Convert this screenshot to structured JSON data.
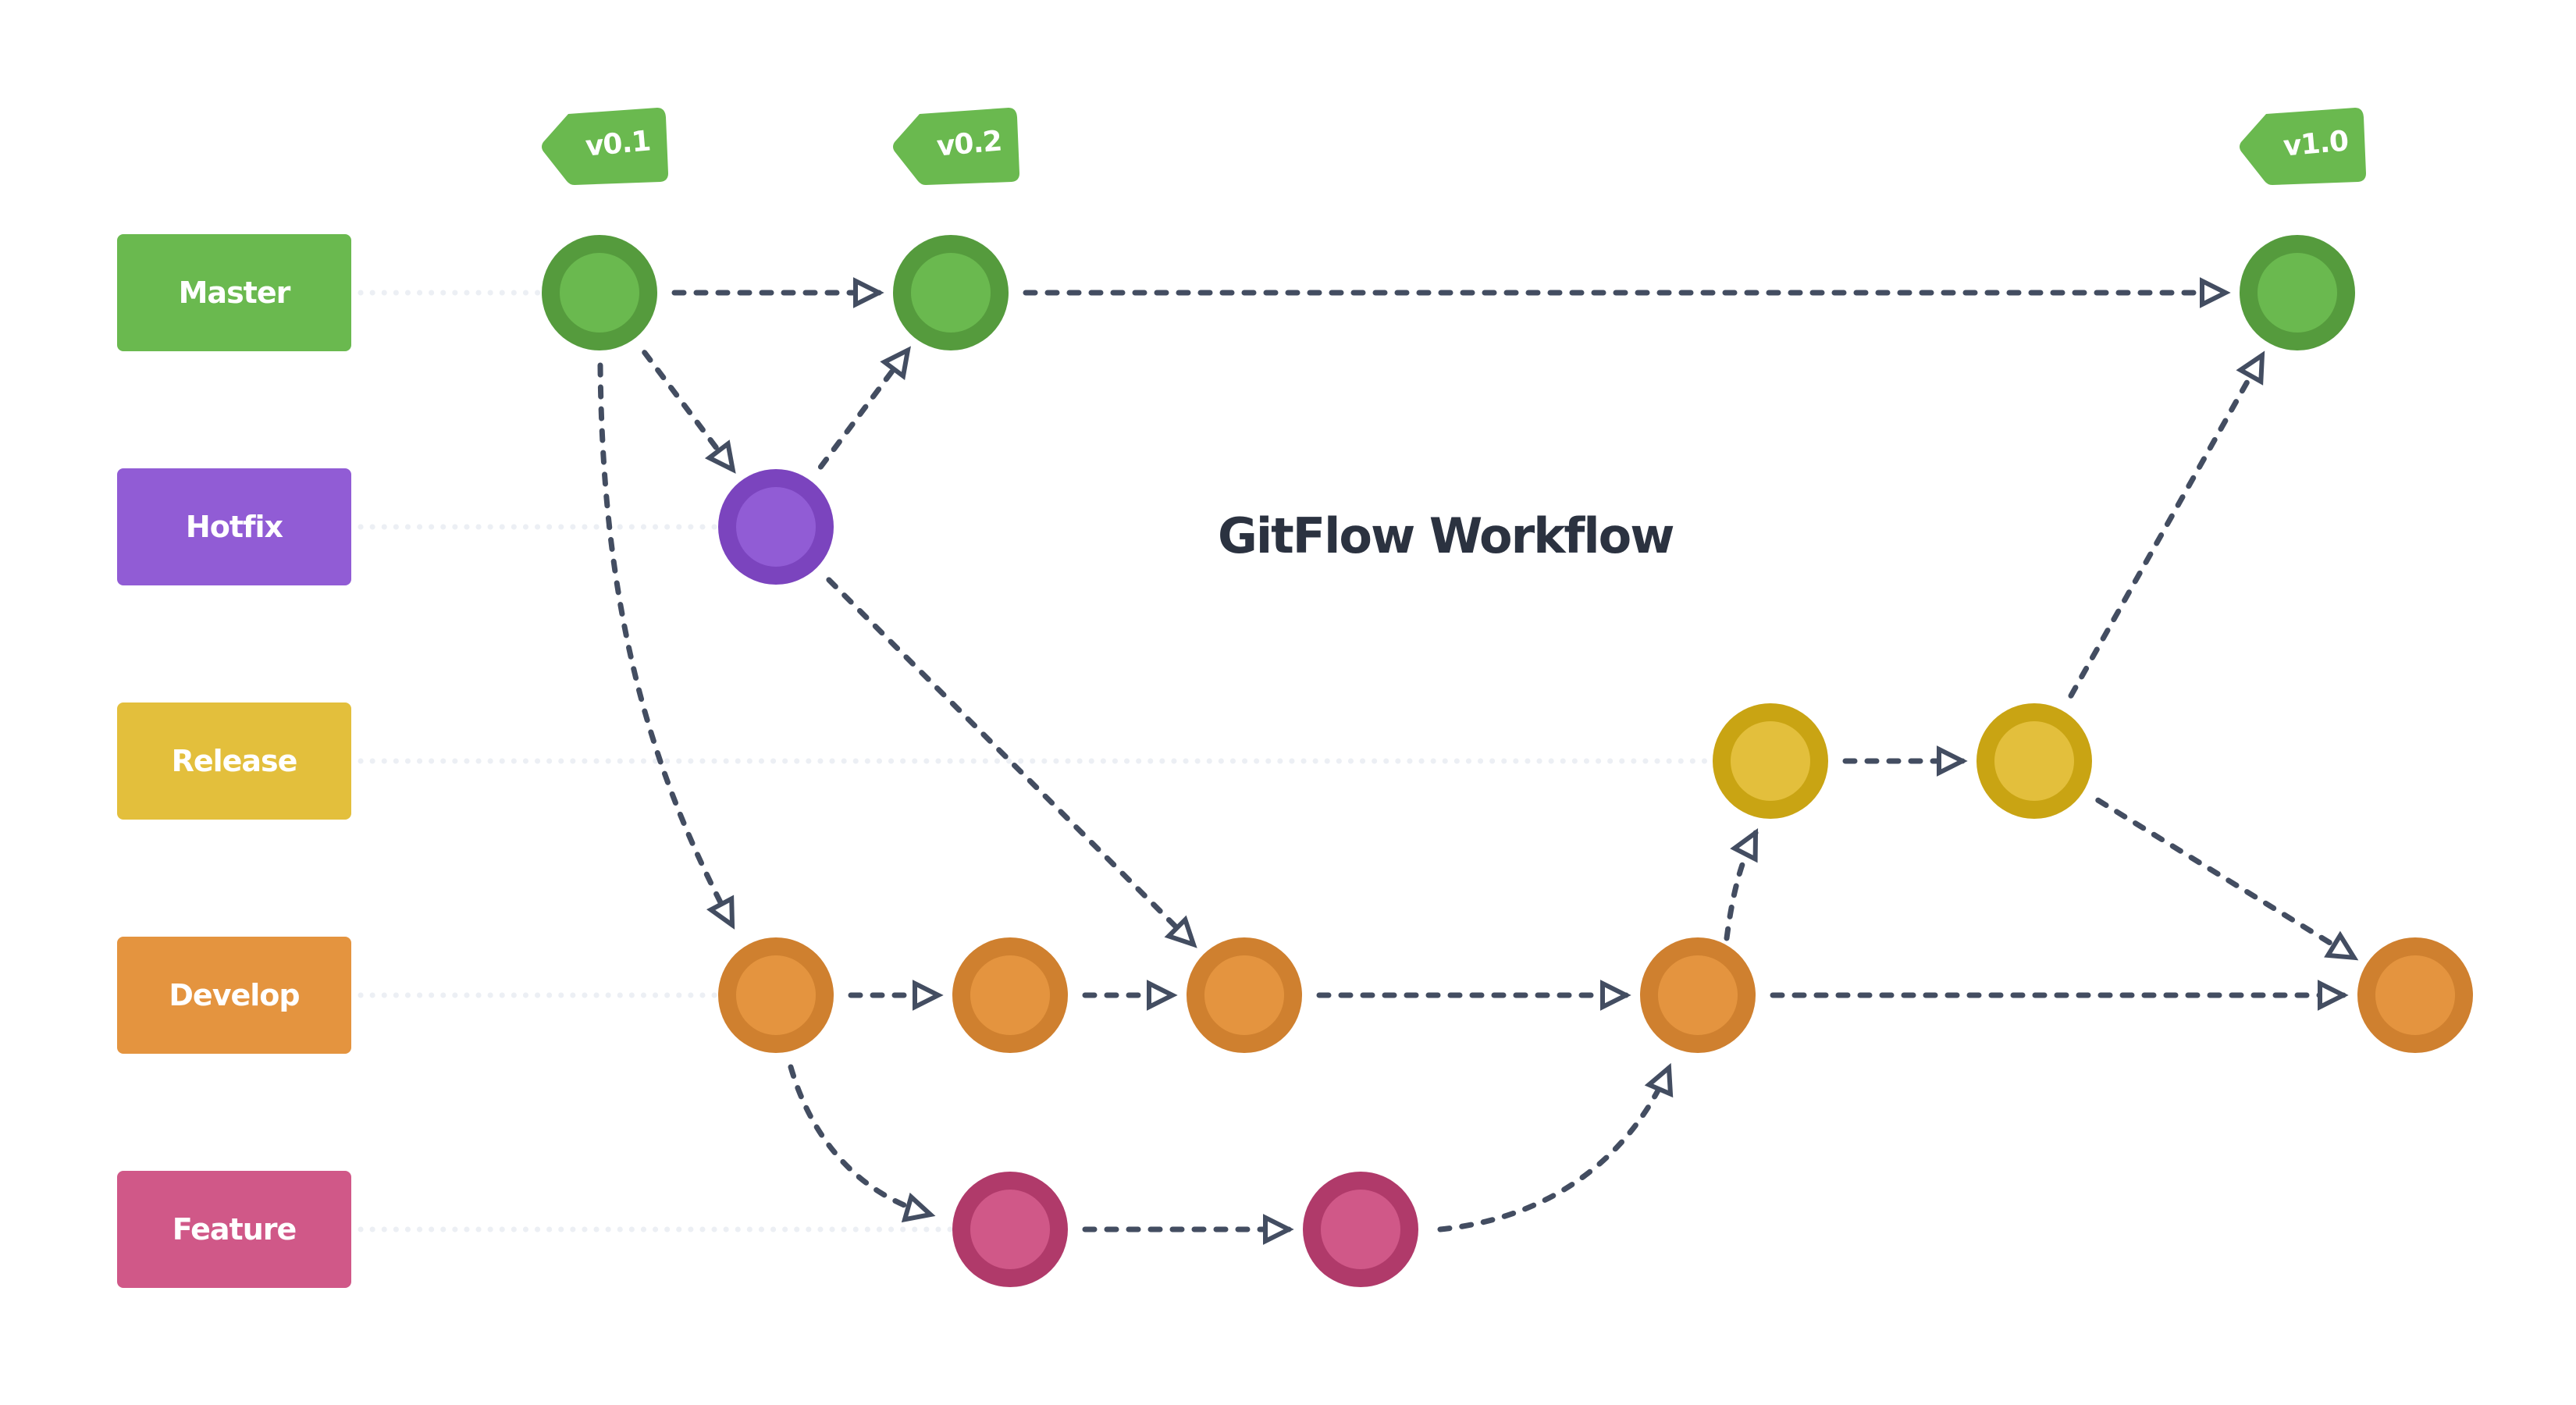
{
  "title": "GitFlow Workflow",
  "colors": {
    "arrow": "#434d61",
    "guide": "#eceff4",
    "tag": "#6ab94f"
  },
  "branches": [
    {
      "id": "master",
      "label": "Master",
      "fill": "#6ab94f",
      "ring": "#559b3d"
    },
    {
      "id": "hotfix",
      "label": "Hotfix",
      "fill": "#915cd5",
      "ring": "#7b44be"
    },
    {
      "id": "release",
      "label": "Release",
      "fill": "#e3bf3c",
      "ring": "#c9a413"
    },
    {
      "id": "develop",
      "label": "Develop",
      "fill": "#e4943f",
      "ring": "#cf802f"
    },
    {
      "id": "feature",
      "label": "Feature",
      "fill": "#d05888",
      "ring": "#b03a6a"
    }
  ],
  "tags": [
    {
      "label": "v0.1",
      "commit": "m1"
    },
    {
      "label": "v0.2",
      "commit": "m2"
    },
    {
      "label": "v1.0",
      "commit": "m3"
    }
  ],
  "commits": [
    {
      "id": "m1",
      "branch": "master",
      "column": 1
    },
    {
      "id": "m2",
      "branch": "master",
      "column": 3
    },
    {
      "id": "m3",
      "branch": "master",
      "column": 11
    },
    {
      "id": "h1",
      "branch": "hotfix",
      "column": 2
    },
    {
      "id": "r1",
      "branch": "release",
      "column": 8
    },
    {
      "id": "r2",
      "branch": "release",
      "column": 9
    },
    {
      "id": "d1",
      "branch": "develop",
      "column": 2
    },
    {
      "id": "d2",
      "branch": "develop",
      "column": 4
    },
    {
      "id": "d3",
      "branch": "develop",
      "column": 5
    },
    {
      "id": "d4",
      "branch": "develop",
      "column": 7
    },
    {
      "id": "d5",
      "branch": "develop",
      "column": 12
    },
    {
      "id": "f1",
      "branch": "feature",
      "column": 4
    },
    {
      "id": "f2",
      "branch": "feature",
      "column": 6
    }
  ],
  "edges": [
    {
      "from": "m1",
      "to": "m2",
      "kind": "straight"
    },
    {
      "from": "m2",
      "to": "m3",
      "kind": "straight"
    },
    {
      "from": "m1",
      "to": "h1",
      "kind": "straight"
    },
    {
      "from": "h1",
      "to": "m2",
      "kind": "straight"
    },
    {
      "from": "m1",
      "to": "d1",
      "kind": "curve"
    },
    {
      "from": "h1",
      "to": "d3",
      "kind": "straight"
    },
    {
      "from": "d1",
      "to": "d2",
      "kind": "straight"
    },
    {
      "from": "d2",
      "to": "d3",
      "kind": "straight"
    },
    {
      "from": "d3",
      "to": "d4",
      "kind": "straight"
    },
    {
      "from": "d4",
      "to": "d5",
      "kind": "straight"
    },
    {
      "from": "d1",
      "to": "f1",
      "kind": "curve"
    },
    {
      "from": "f1",
      "to": "f2",
      "kind": "straight"
    },
    {
      "from": "f2",
      "to": "d4",
      "kind": "curve"
    },
    {
      "from": "d4",
      "to": "r1",
      "kind": "curve"
    },
    {
      "from": "r1",
      "to": "r2",
      "kind": "straight"
    },
    {
      "from": "r2",
      "to": "m3",
      "kind": "straight"
    },
    {
      "from": "r2",
      "to": "d5",
      "kind": "straight"
    }
  ]
}
